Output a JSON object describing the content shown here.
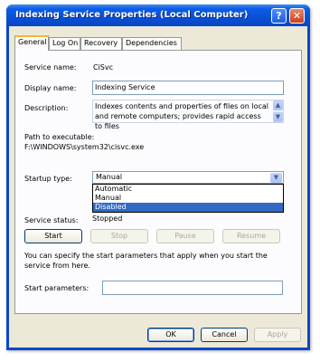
{
  "window": {
    "title": "Indexing Service Properties (Local Computer)",
    "help_glyph": "?",
    "close_glyph": "✕"
  },
  "tabs": [
    {
      "label": "General"
    },
    {
      "label": "Log On"
    },
    {
      "label": "Recovery"
    },
    {
      "label": "Dependencies"
    }
  ],
  "general": {
    "service_name_label": "Service name:",
    "service_name_value": "CiSvc",
    "display_name_label": "Display name:",
    "display_name_value": "Indexing Service",
    "description_label": "Description:",
    "description_value": "Indexes contents and properties of files on local and remote computers; provides rapid access to files",
    "path_label": "Path to executable:",
    "path_value": "F:\\WINDOWS\\system32\\cisvc.exe",
    "startup_type_label": "Startup type:",
    "startup_type_value": "Manual",
    "startup_options": [
      "Automatic",
      "Manual",
      "Disabled"
    ],
    "startup_highlighted": "Disabled",
    "service_status_label": "Service status:",
    "service_status_value": "Stopped",
    "start_label": "Start",
    "stop_label": "Stop",
    "pause_label": "Pause",
    "resume_label": "Resume",
    "start_params_hint": "You can specify the start parameters that apply when you start the service from here.",
    "start_params_label": "Start parameters:",
    "start_params_value": ""
  },
  "footer": {
    "ok_label": "OK",
    "cancel_label": "Cancel",
    "apply_label": "Apply"
  },
  "icons": {
    "scroll_up": "scroll-up-arrow-icon",
    "scroll_down": "scroll-down-arrow-icon",
    "dropdown": "chevron-down-icon"
  },
  "colors": {
    "titlebar": "#0a4fd6",
    "dialog_bg": "#ece9d8",
    "selection": "#316ac5"
  }
}
